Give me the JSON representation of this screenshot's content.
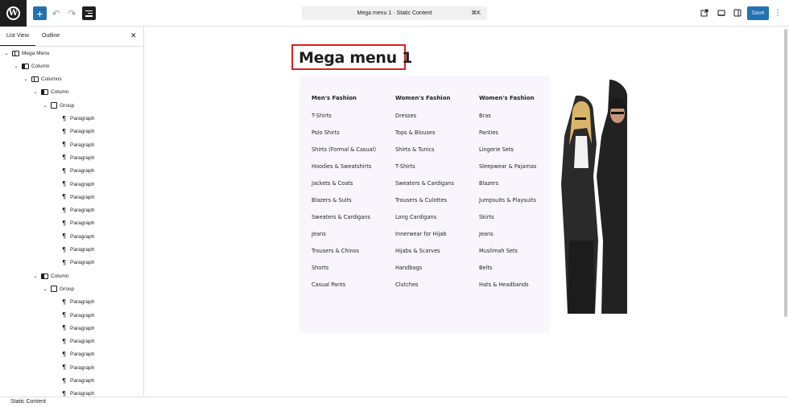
{
  "toolbar": {
    "add_icon": "plus-icon",
    "undo_icon": "undo-icon",
    "redo_icon": "redo-icon",
    "document_title": "Mega menu 1 · Static Content",
    "shortcut": "⌘K",
    "save_label": "Save"
  },
  "sidebar": {
    "tabs": [
      "List View",
      "Outline"
    ],
    "tree": [
      {
        "label": "Mega Menu",
        "icon": "columns-icon",
        "depth": 0,
        "expanded": true
      },
      {
        "label": "Column",
        "icon": "column-icon",
        "depth": 1,
        "expanded": true
      },
      {
        "label": "Columns",
        "icon": "columns-icon",
        "depth": 2,
        "expanded": true
      },
      {
        "label": "Column",
        "icon": "column-icon",
        "depth": 3,
        "expanded": true
      },
      {
        "label": "Group",
        "icon": "group-icon",
        "depth": 4,
        "expanded": true
      },
      {
        "label": "Paragraph",
        "icon": "paragraph-icon",
        "depth": 5
      },
      {
        "label": "Paragraph",
        "icon": "paragraph-icon",
        "depth": 5
      },
      {
        "label": "Paragraph",
        "icon": "paragraph-icon",
        "depth": 5
      },
      {
        "label": "Paragraph",
        "icon": "paragraph-icon",
        "depth": 5
      },
      {
        "label": "Paragraph",
        "icon": "paragraph-icon",
        "depth": 5
      },
      {
        "label": "Paragraph",
        "icon": "paragraph-icon",
        "depth": 5
      },
      {
        "label": "Paragraph",
        "icon": "paragraph-icon",
        "depth": 5
      },
      {
        "label": "Paragraph",
        "icon": "paragraph-icon",
        "depth": 5
      },
      {
        "label": "Paragraph",
        "icon": "paragraph-icon",
        "depth": 5
      },
      {
        "label": "Paragraph",
        "icon": "paragraph-icon",
        "depth": 5
      },
      {
        "label": "Paragraph",
        "icon": "paragraph-icon",
        "depth": 5
      },
      {
        "label": "Paragraph",
        "icon": "paragraph-icon",
        "depth": 5
      },
      {
        "label": "Column",
        "icon": "column-icon",
        "depth": 3,
        "expanded": true
      },
      {
        "label": "Group",
        "icon": "group-icon",
        "depth": 4,
        "expanded": true
      },
      {
        "label": "Paragraph",
        "icon": "paragraph-icon",
        "depth": 5
      },
      {
        "label": "Paragraph",
        "icon": "paragraph-icon",
        "depth": 5
      },
      {
        "label": "Paragraph",
        "icon": "paragraph-icon",
        "depth": 5
      },
      {
        "label": "Paragraph",
        "icon": "paragraph-icon",
        "depth": 5
      },
      {
        "label": "Paragraph",
        "icon": "paragraph-icon",
        "depth": 5
      },
      {
        "label": "Paragraph",
        "icon": "paragraph-icon",
        "depth": 5
      },
      {
        "label": "Paragraph",
        "icon": "paragraph-icon",
        "depth": 5
      },
      {
        "label": "Paragraph",
        "icon": "paragraph-icon",
        "depth": 5
      }
    ]
  },
  "canvas": {
    "title": "Mega menu 1",
    "columns": [
      {
        "heading": "Men's Fashion",
        "items": [
          "T-Shirts",
          "Polo Shirts",
          "Shirts (Formal & Casual)",
          "Hoodies & Sweatshirts",
          "Jackets & Coats",
          "Blazers & Suits",
          "Sweaters & Cardigans",
          "Jeans",
          "Trousers & Chinos",
          "Shorts",
          "Casual Pants"
        ]
      },
      {
        "heading": "Women's Fashion",
        "items": [
          "Dresses",
          "Tops & Blouses",
          "Shirts & Tunics",
          "T-Shirts",
          "Sweaters & Cardigans",
          "Trousers & Culottes",
          "Long Cardigans",
          "Innerwear for Hijab",
          "Hijabs & Scarves",
          "Handbags",
          "Clutches"
        ]
      },
      {
        "heading": "Women's Fashion",
        "items": [
          "Bras",
          "Panties",
          "Lingerie Sets",
          "Sleepwear & Pajamas",
          "Blazers",
          "Jumpsuits & Playsuits",
          "Skirts",
          "Jeans",
          "Muslimah Sets",
          "Belts",
          "Hats & Headbands"
        ]
      }
    ],
    "hero_image": "fashion-models-image"
  },
  "statusbar": {
    "breadcrumb": "Static Content"
  },
  "colors": {
    "accent": "#2271b1",
    "highlight": "#d92121",
    "panel": "#f8f6fc"
  }
}
